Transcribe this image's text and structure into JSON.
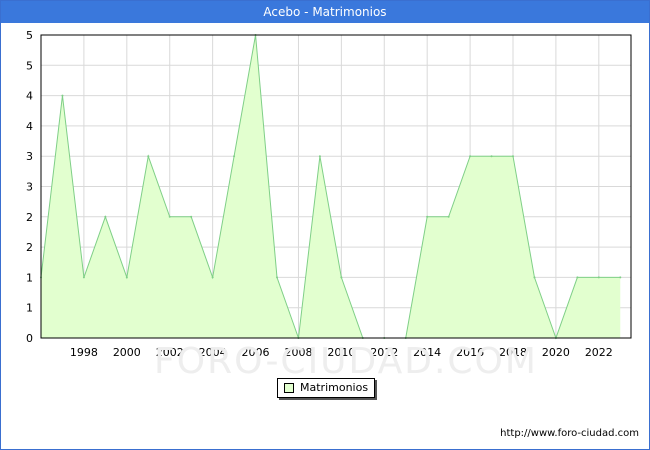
{
  "title": "Acebo - Matrimonios",
  "footer_url": "http://www.foro-ciudad.com",
  "watermark": "FORO-CIUDAD.COM",
  "colors": {
    "title_bg": "#3a78dc",
    "fill": "#e2ffcf",
    "line": "#7fcf87",
    "grid": "#d9d9d9"
  },
  "chart_data": {
    "type": "area",
    "title": "Acebo - Matrimonios",
    "x": [
      1996,
      1997,
      1998,
      1999,
      2000,
      2001,
      2002,
      2003,
      2004,
      2005,
      2006,
      2007,
      2008,
      2009,
      2010,
      2011,
      2012,
      2013,
      2014,
      2015,
      2016,
      2017,
      2018,
      2019,
      2020,
      2021,
      2022,
      2023
    ],
    "series": [
      {
        "name": "Matrimonios",
        "values": [
          1,
          4,
          1,
          2,
          1,
          3,
          2,
          2,
          1,
          3,
          5,
          1,
          0,
          3,
          1,
          0,
          0,
          0,
          2,
          2,
          3,
          3,
          3,
          1,
          0,
          1,
          1,
          1
        ]
      }
    ],
    "x_tick_labels": [
      "1998",
      "2000",
      "2002",
      "2004",
      "2006",
      "2008",
      "2010",
      "2012",
      "2014",
      "2016",
      "2018",
      "2020",
      "2022"
    ],
    "y_tick_labels": [
      "0",
      "1",
      "1",
      "2",
      "2",
      "3",
      "3",
      "4",
      "4",
      "5",
      "5"
    ],
    "ylim": [
      0,
      5
    ],
    "grid": true,
    "legend": "bottom-center"
  }
}
